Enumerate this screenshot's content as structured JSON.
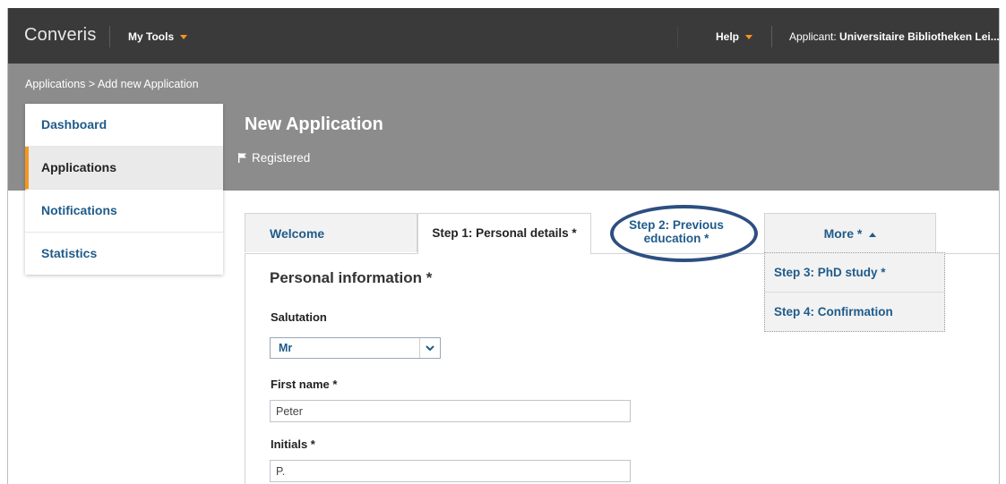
{
  "header": {
    "brand": "Converis",
    "my_tools": "My Tools",
    "help": "Help",
    "applicant_prefix": "Applicant: ",
    "applicant_name": "Universitaire Bibliotheken Lei... ("
  },
  "breadcrumb": "Applications > Add new Application",
  "page": {
    "title": "New Application",
    "status": "Registered"
  },
  "sidebar": {
    "items": [
      {
        "label": "Dashboard"
      },
      {
        "label": "Applications"
      },
      {
        "label": "Notifications"
      },
      {
        "label": "Statistics"
      }
    ]
  },
  "tabs": {
    "welcome": "Welcome",
    "step1": "Step 1: Personal details *",
    "step2_line1": "Step 2: Previous",
    "step2_line2": "education *",
    "more": "More *"
  },
  "dropdown": {
    "items": [
      {
        "label": "Step 3: PhD study *"
      },
      {
        "label": "Step 4: Confirmation"
      }
    ]
  },
  "form": {
    "section_title": "Personal information *",
    "salutation_label": "Salutation",
    "salutation_value": "Mr",
    "first_name_label": "First name *",
    "first_name_value": "Peter",
    "initials_label": "Initials *",
    "initials_value": "P."
  },
  "colors": {
    "topbar": "#3a3a3a",
    "header_band": "#8c8c8c",
    "accent": "#f5961d",
    "link": "#1f5b8a",
    "highlight_circle": "#2d4f80"
  },
  "icons": {
    "flag": "flag-icon",
    "caret": "caret-down-icon",
    "chevron": "chevron-down-icon",
    "up": "caret-up-icon"
  }
}
